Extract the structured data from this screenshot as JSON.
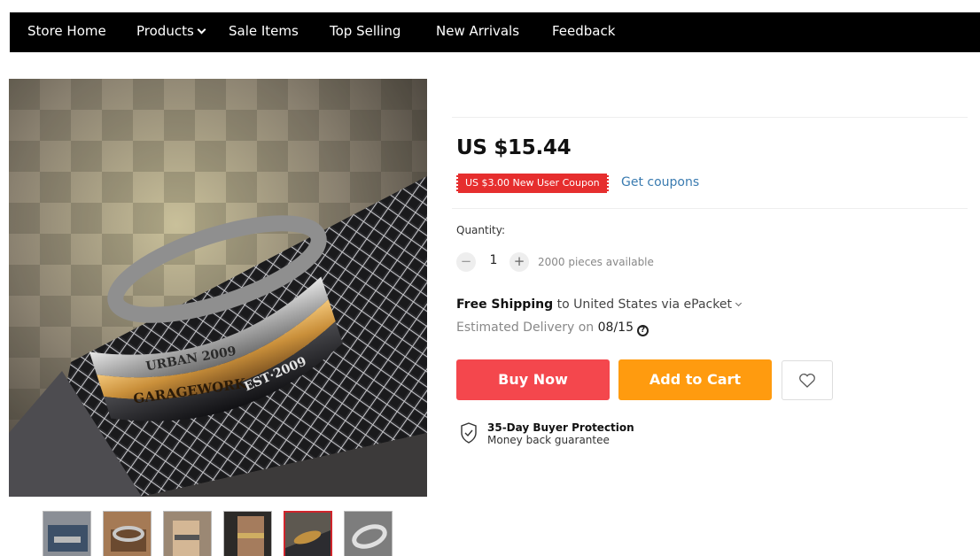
{
  "nav": {
    "items": [
      {
        "label": "Store Home"
      },
      {
        "label": "Products"
      },
      {
        "label": "Sale Items"
      },
      {
        "label": "Top Selling"
      },
      {
        "label": "New Arrivals"
      },
      {
        "label": "Feedback"
      }
    ]
  },
  "product": {
    "bracelet_text": {
      "line1": "URBAN 2009",
      "line2": "GARAGEWORK",
      "line3": "EST·2009"
    },
    "thumbnail_count": 6,
    "active_thumbnail": 5,
    "price": "US $15.44",
    "coupon": "US $3.00 New User Coupon",
    "get_coupons": "Get coupons",
    "quantity_label": "Quantity:",
    "quantity": "1",
    "decrement": "−",
    "increment": "+",
    "available": "2000 pieces available",
    "shipping": {
      "free": "Free Shipping",
      "rest": " to United States via ePacket"
    },
    "delivery": {
      "label": "Estimated Delivery on ",
      "date": "08/15",
      "help": "?"
    },
    "buy_now": "Buy Now",
    "add_to_cart": "Add to Cart",
    "protection": {
      "title": "35-Day Buyer Protection",
      "subtitle": "Money back guarantee"
    }
  },
  "colors": {
    "nav_bg": "#000000",
    "buy_now": "#f4474d",
    "add_to_cart": "#ff9b0f",
    "coupon": "#e62e2e",
    "link": "#3a7bb0",
    "active_thumb_border": "#d0242b"
  },
  "icons": {
    "products_dropdown": "chevron-down-icon",
    "wishlist": "heart-icon",
    "protection": "shield-check-icon",
    "delivery_help": "question-circle-icon"
  }
}
